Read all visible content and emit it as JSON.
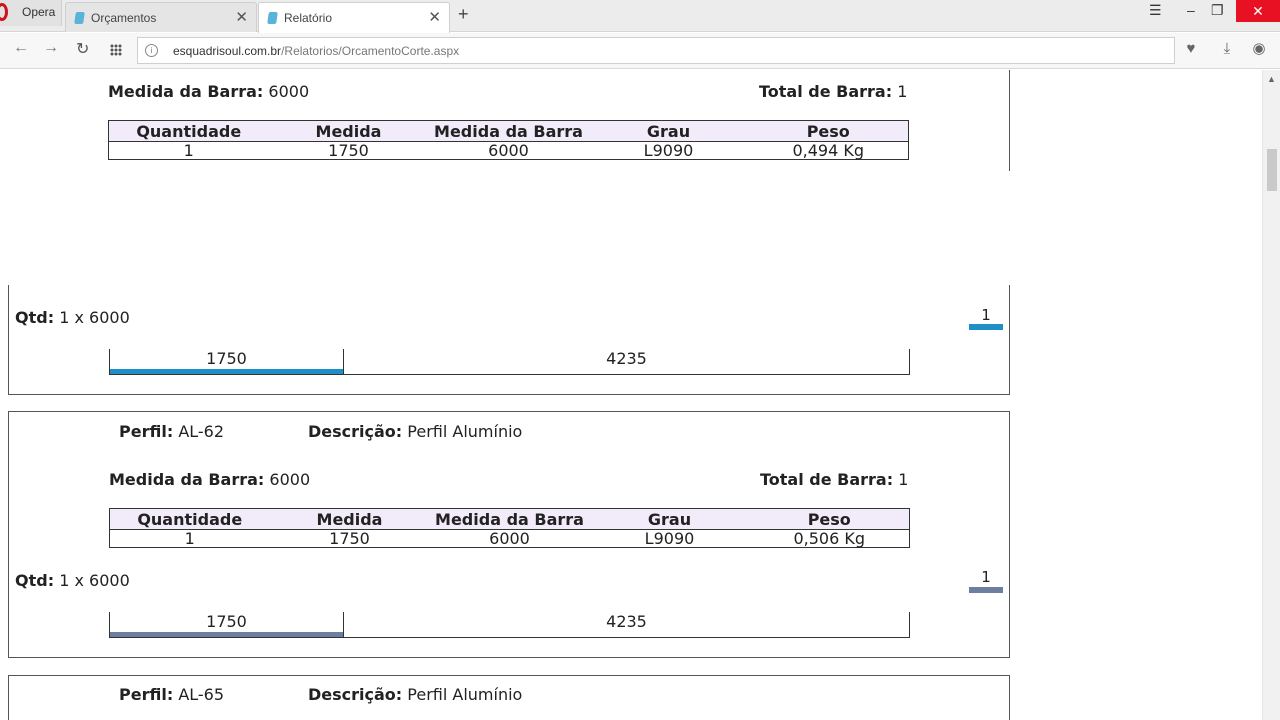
{
  "browser": {
    "app_name": "Opera",
    "tabs": [
      {
        "label": "Orçamentos",
        "close": "✕"
      },
      {
        "label": "Relatório",
        "close": "✕"
      }
    ],
    "new_tab": "+",
    "url_domain": "esquadrisoul.com.br",
    "url_path": "/Relatorios/OrcamentoCorte.aspx"
  },
  "labels": {
    "medida_barra": "Medida da Barra:",
    "total_barra": "Total de Barra:",
    "perfil": "Perfil:",
    "descricao": "Descrição:",
    "qtd": "Qtd:"
  },
  "table_headers": [
    "Quantidade",
    "Medida",
    "Medida da Barra",
    "Grau",
    "Peso"
  ],
  "block1": {
    "medida_barra": "6000",
    "total_barra": "1",
    "row": [
      "1",
      "1750",
      "6000",
      "L9090",
      "0,494 Kg"
    ],
    "qtd": "1 x 6000",
    "legend_num": "1",
    "color": "#1e8fc7",
    "cut_fraction": 0.2917,
    "segments": {
      "cut": "1750",
      "rest": "4235"
    }
  },
  "block2": {
    "perfil": "AL-62",
    "descricao": "Perfil Alumínio",
    "medida_barra": "6000",
    "total_barra": "1",
    "row": [
      "1",
      "1750",
      "6000",
      "L9090",
      "0,506 Kg"
    ],
    "qtd": "1 x 6000",
    "legend_num": "1",
    "color": "#6d7fa0",
    "cut_fraction": 0.2917,
    "segments": {
      "cut": "1750",
      "rest": "4235"
    }
  },
  "block3": {
    "perfil": "AL-65",
    "descricao": "Perfil Alumínio"
  }
}
